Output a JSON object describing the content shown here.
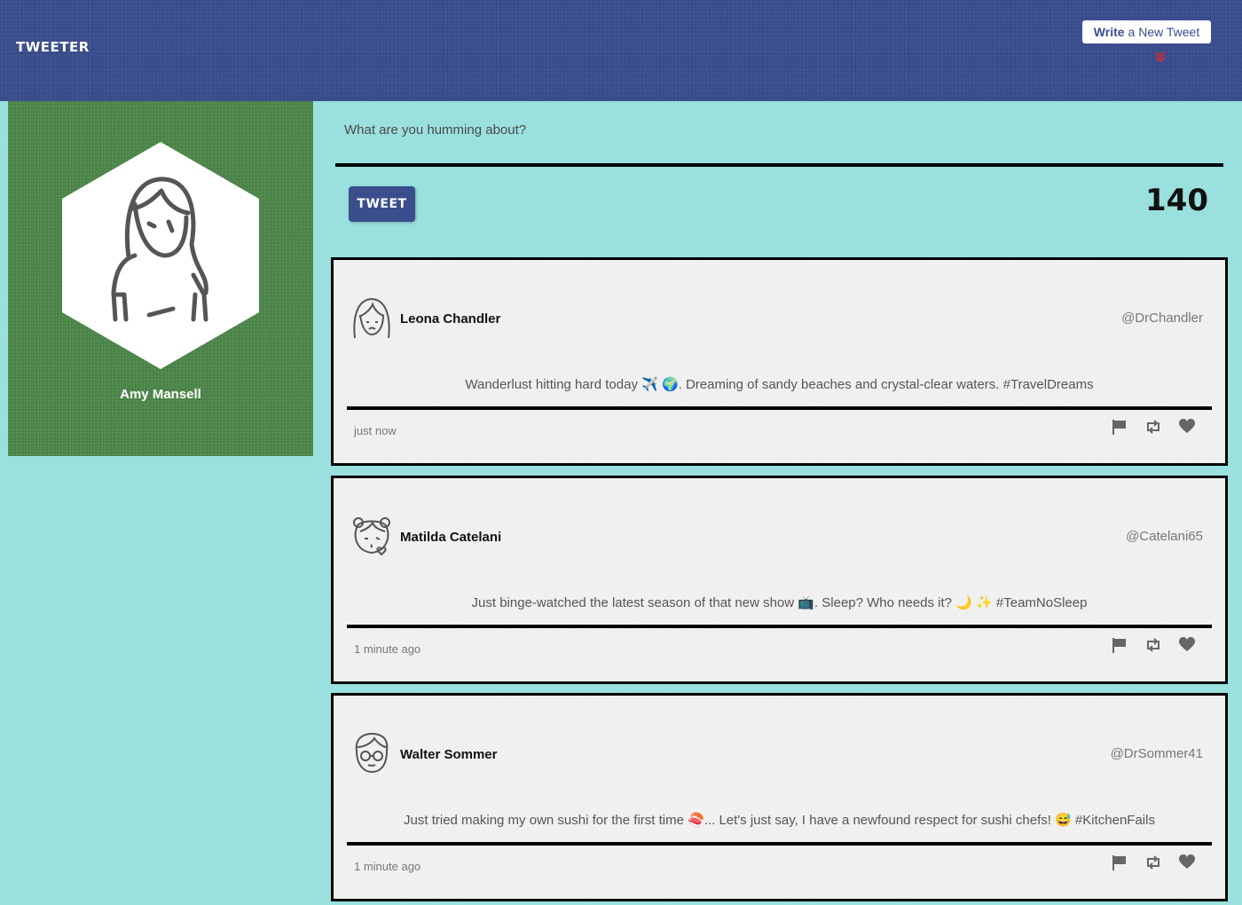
{
  "header": {
    "brand": "TWEETER",
    "compose_bold": "Write",
    "compose_rest": "a New Tweet",
    "compose_arrow_icon": "double-chevron-down-icon",
    "arrow_color": "#d42a2a"
  },
  "profile": {
    "name": "Amy Mansell",
    "avatar_icon": "woman-avatar-icon"
  },
  "composer": {
    "placeholder": "What are you humming about?",
    "submit_label": "TWEET",
    "counter": "140"
  },
  "colors": {
    "background": "#9ae0de",
    "header": "#3a4d8d",
    "profile_card": "#4f8a4c",
    "tweet_card": "#f2f2f2"
  },
  "tweets": [
    {
      "author": "Leona Chandler",
      "handle": "@DrChandler",
      "body": "Wanderlust hitting hard today ✈️ 🌍. Dreaming of sandy beaches and crystal-clear waters. #TravelDreams",
      "time": "just now",
      "avatar_icon": "woman-avatar-icon"
    },
    {
      "author": "Matilda Catelani",
      "handle": "@Catelani65",
      "body": "Just binge-watched the latest season of that new show 📺. Sleep? Who needs it? 🌙 ✨ #TeamNoSleep",
      "time": "1 minute ago",
      "avatar_icon": "girl-kiss-avatar-icon"
    },
    {
      "author": "Walter Sommer",
      "handle": "@DrSommer41",
      "body": "Just tried making my own sushi for the first time 🍣... Let's just say, I have a newfound respect for sushi chefs! 😅 #KitchenFails",
      "time": "1 minute ago",
      "avatar_icon": "man-glasses-avatar-icon"
    }
  ]
}
